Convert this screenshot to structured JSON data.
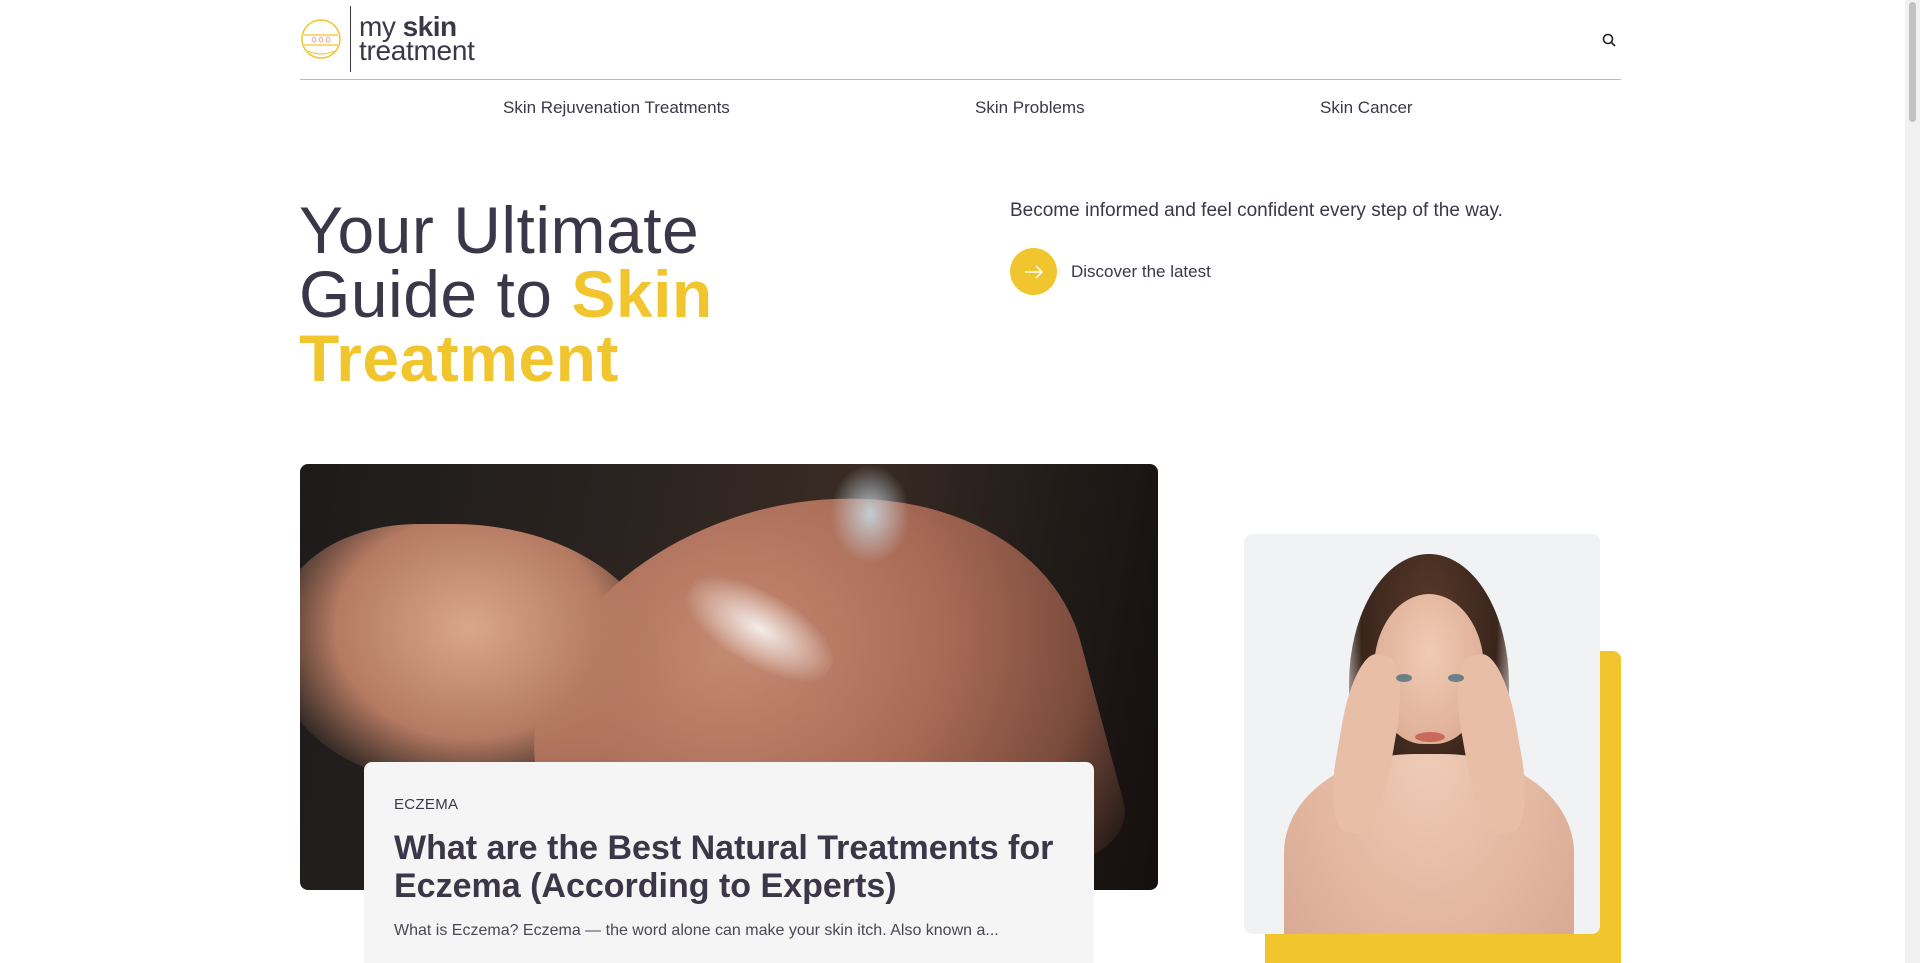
{
  "brand": {
    "logo_line1_prefix": "my",
    "logo_line1_bold": "skin",
    "logo_line2": "treatment",
    "accent_color": "#f0c52e",
    "text_color": "#3b3748"
  },
  "header": {
    "search_icon": "search-icon"
  },
  "nav": {
    "items": [
      {
        "label": "Skin Rejuvenation Treatments"
      },
      {
        "label": "Skin Problems"
      },
      {
        "label": "Skin Cancer"
      }
    ]
  },
  "hero": {
    "title_line1": "Your Ultimate",
    "title_line2_plain": "Guide to ",
    "title_line2_accent": "Skin",
    "title_line3_accent": "Treatment",
    "subtitle": "Become informed and feel confident every step of the way.",
    "cta_label": "Discover the latest",
    "cta_icon": "arrow-right-icon"
  },
  "featured_article": {
    "category": "ECZEMA",
    "title": "What are the Best Natural Treatments for Eczema (According to Experts)",
    "excerpt": "What is Eczema? Eczema — the word alone can make your skin itch. Also known a..."
  }
}
